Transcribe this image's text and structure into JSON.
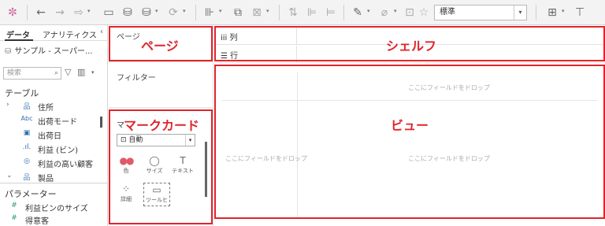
{
  "toolbar": {
    "style_select": "標準"
  },
  "data_pane": {
    "tabs": [
      "データ",
      "アナリティクス"
    ],
    "collapse_glyph": "‹",
    "datasource": "サンプル - スーパー...",
    "search_placeholder": "検索",
    "tables_heading": "テーブル",
    "fields": [
      {
        "type": "Abc",
        "label": "住所",
        "color": "#4a7ebb",
        "expander": "›",
        "icon": "品"
      },
      {
        "type": "Abc",
        "label": "出荷モード",
        "color": "#2f6db3",
        "expander": "",
        "icon": "Abc"
      },
      {
        "type": "date",
        "label": "出荷日",
        "color": "#2f6db3",
        "expander": "",
        "icon": "▣"
      },
      {
        "type": "bin",
        "label": "利益 (ビン)",
        "color": "#2f6db3",
        "expander": "",
        "icon": ".ıl."
      },
      {
        "type": "set",
        "label": "利益の高い顧客",
        "color": "#2f6db3",
        "expander": "",
        "icon": "◎"
      },
      {
        "type": "hier",
        "label": "製品",
        "color": "#4a7ebb",
        "expander": "⌄",
        "icon": "品"
      }
    ],
    "params_heading": "パラメーター",
    "params": [
      {
        "label": "利益ビンのサイズ",
        "icon": "#"
      },
      {
        "label": "得意客",
        "icon": "#"
      }
    ]
  },
  "cards": {
    "pages_title": "ページ",
    "filters_title": "フィルター",
    "marks_title": "マ",
    "mark_type": "自動",
    "mark_type_icon": "⊡",
    "mark_buttons": [
      {
        "label": "色",
        "icon": "●●"
      },
      {
        "label": "サイズ",
        "icon": "◯"
      },
      {
        "label": "テキスト",
        "icon": "T"
      },
      {
        "label": "詳細",
        "icon": "⁘"
      },
      {
        "label": "ツールヒ",
        "icon": "▭"
      }
    ]
  },
  "shelves": {
    "columns_label": "列",
    "columns_icon": "iii",
    "rows_label": "行",
    "rows_icon": "☰"
  },
  "view": {
    "drop_top": "ここにフィールドをドロップ",
    "drop_left": "ここにフィールドをドロップ",
    "drop_center": "ここにフィールドをドロップ"
  },
  "annotations": {
    "pages": "ページ",
    "shelf": "シェルフ",
    "marks": "マークカード",
    "view": "ビュー",
    "color": "#e0242c"
  }
}
